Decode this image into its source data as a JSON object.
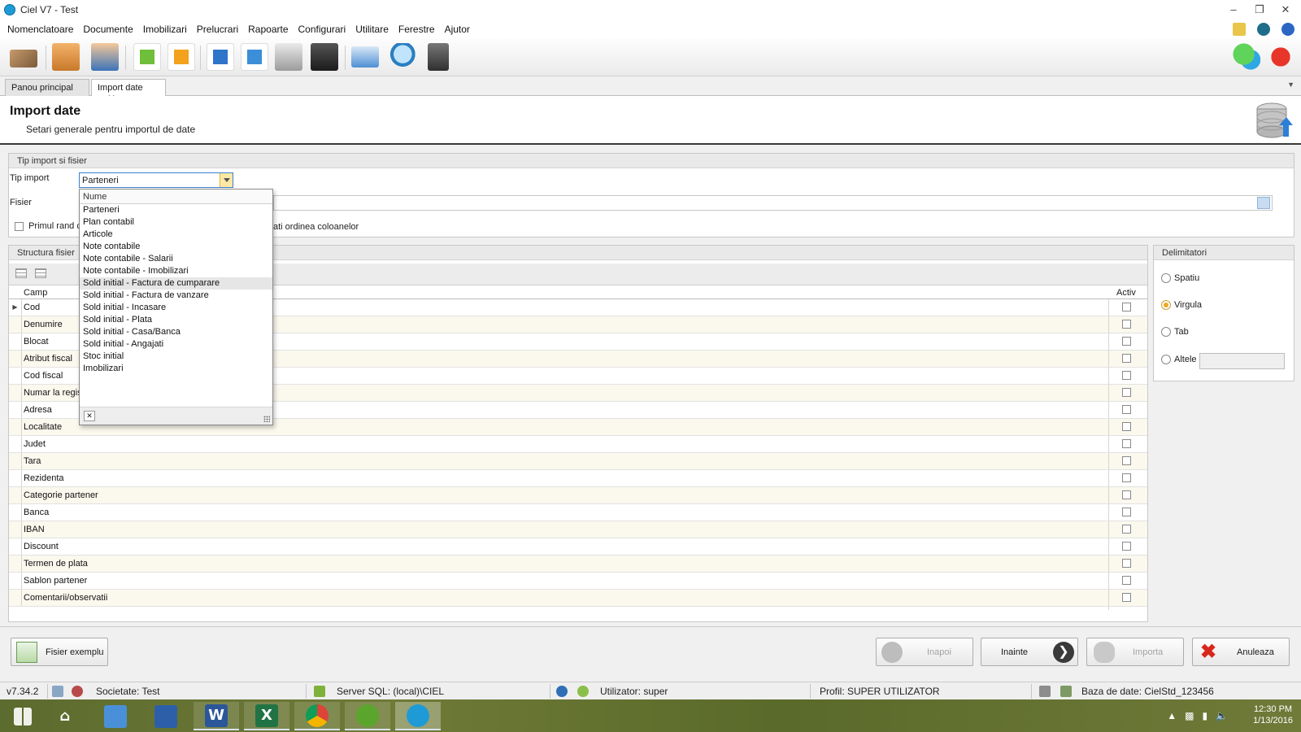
{
  "window": {
    "title": "Ciel V7 - Test",
    "controls": [
      "–",
      "❐",
      "✕"
    ]
  },
  "menu": [
    "Nomenclatoare",
    "Documente",
    "Imobilizari",
    "Prelucrari",
    "Rapoarte",
    "Configurari",
    "Utilitare",
    "Ferestre",
    "Ajutor"
  ],
  "tabs": [
    {
      "label": "Panou principal"
    },
    {
      "label": "Import date",
      "close": "✕"
    }
  ],
  "header": {
    "title": "Import date",
    "subtitle": "Setari generale pentru importul de date"
  },
  "import_section": {
    "title": "Tip import si fisier",
    "tip_import_label": "Tip import",
    "tip_import_value": "Parteneri",
    "fisier_label": "Fisier",
    "fisier_value": "",
    "first_row_label": "Primul rand co",
    "order_label": "ati ordinea coloanelor"
  },
  "dropdown": {
    "header": "Nume",
    "items": [
      "Parteneri",
      "Plan contabil",
      "Articole",
      "Note contabile",
      "Note contabile - Salarii",
      "Note contabile - Imobilizari",
      "Sold initial - Factura de cumparare",
      "Sold initial - Factura de vanzare",
      "Sold initial - Incasare",
      "Sold initial - Plata",
      "Sold initial - Casa/Banca",
      "Sold initial - Angajati",
      "Stoc initial",
      "Imobilizari"
    ],
    "highlighted": "Sold initial - Factura de cumparare",
    "close_glyph": "✕"
  },
  "structure": {
    "title": "Structura fisier",
    "columns": {
      "camp": "Camp",
      "activ": "Activ"
    },
    "rows": [
      "Cod",
      "Denumire",
      "Blocat",
      "Atribut fiscal",
      "Cod fiscal",
      "Numar la regis",
      "Adresa",
      "Localitate",
      "Judet",
      "Tara",
      "Rezidenta",
      "Categorie partener",
      "Banca",
      "IBAN",
      "Discount",
      "Termen de plata",
      "Sablon partener",
      "Comentarii/observatii"
    ],
    "current_row_marker": "▶"
  },
  "delimiters": {
    "title": "Delimitatori",
    "options": [
      "Spatiu",
      "Virgula",
      "Tab",
      "Altele"
    ],
    "selected": "Virgula",
    "altele_value": ""
  },
  "actions": {
    "fisier_exemplu": "Fisier exemplu",
    "inapoi": "Inapoi",
    "inainte": "Inainte",
    "importa": "Importa",
    "anuleaza": "Anuleaza"
  },
  "statusbar": {
    "version": "v7.34.2",
    "societate": "Societate: Test",
    "server": "Server SQL: (local)\\CIEL",
    "utilizator": "Utilizator: super",
    "profil": "Profil: SUPER UTILIZATOR",
    "baza": "Baza de date: CielStd_123456"
  },
  "taskbar": {
    "time": "12:30 PM",
    "date": "1/13/2016",
    "apps": [
      "start",
      "home",
      "control-panel",
      "computer",
      "word",
      "excel",
      "chrome",
      "cloud",
      "ciel"
    ]
  },
  "colors": {
    "accent_combo_btn": "#fde9a5",
    "radio_selected": "#f2a51d",
    "cancel_red": "#d9261c",
    "ciel_blue": "#1e9bd6"
  }
}
